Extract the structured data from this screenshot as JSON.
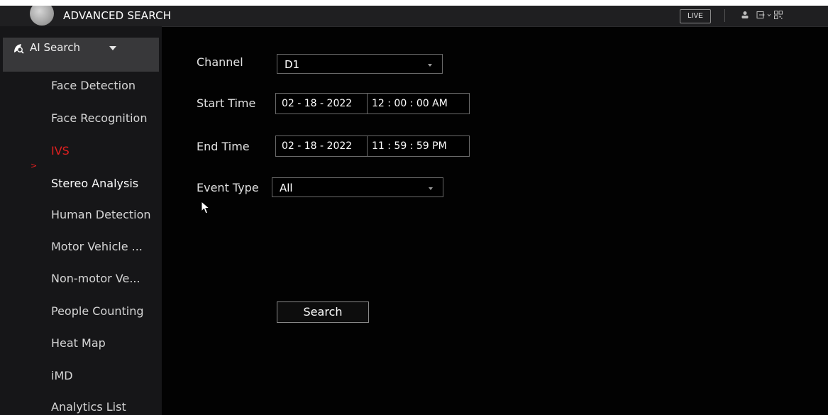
{
  "header": {
    "title": "ADVANCED SEARCH",
    "live_label": "LIVE",
    "icons": [
      "user-icon",
      "logout-icon",
      "qr-code-icon"
    ]
  },
  "sidebar": {
    "header_label": "AI Search",
    "items": [
      {
        "label": "Face Detection",
        "state": "normal"
      },
      {
        "label": "Face Recognition",
        "state": "normal"
      },
      {
        "label": "IVS",
        "state": "active"
      },
      {
        "label": "Stereo Analysis",
        "state": "normal"
      },
      {
        "label": "Human Detection",
        "state": "normal"
      },
      {
        "label": "Motor Vehicle ...",
        "state": "normal"
      },
      {
        "label": "Non-motor Ve...",
        "state": "normal"
      },
      {
        "label": "People Counting",
        "state": "normal"
      },
      {
        "label": "Heat Map",
        "state": "normal"
      },
      {
        "label": "iMD",
        "state": "normal"
      },
      {
        "label": "Analytics List",
        "state": "normal"
      }
    ]
  },
  "form": {
    "channel": {
      "label": "Channel",
      "value": "D1"
    },
    "start_time": {
      "label": "Start Time",
      "date": "02 - 18 - 2022",
      "time": "12 : 00 : 00 AM"
    },
    "end_time": {
      "label": "End Time",
      "date": "02 - 18 - 2022",
      "time": "11 : 59 : 59 PM"
    },
    "event_type": {
      "label": "Event Type",
      "value": "All"
    },
    "search_label": "Search"
  },
  "colors": {
    "active": "#e02020",
    "background": "#020202",
    "sidebar": "#161618"
  }
}
